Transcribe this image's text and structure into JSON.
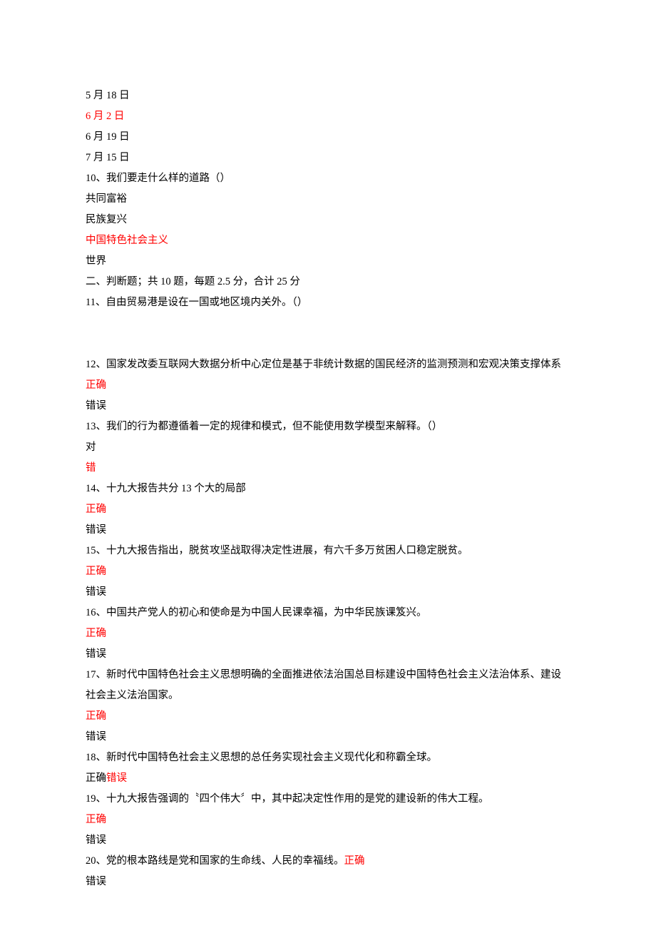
{
  "lines": [
    {
      "text": "5 月 18 日",
      "red": false
    },
    {
      "text": "6 月 2 日",
      "red": true
    },
    {
      "text": "6 月 19 日",
      "red": false
    },
    {
      "text": "7 月 15 日",
      "red": false
    },
    {
      "text": "10、我们要走什么样的道路（）",
      "red": false
    },
    {
      "text": "共同富裕",
      "red": false
    },
    {
      "text": "民族复兴",
      "red": false
    },
    {
      "text": "中国特色社会主义",
      "red": true
    },
    {
      "text": "世界",
      "red": false
    },
    {
      "text": "二、判断题；共 10 题，每题 2.5 分，合计 25 分",
      "red": false
    },
    {
      "text": "11、自由贸易港是设在一国或地区境内关外。（）",
      "red": false
    },
    {
      "text": "",
      "red": false
    },
    {
      "text": "",
      "red": false
    }
  ],
  "mixed": [
    {
      "segments": [
        {
          "text": "12、国家发改委互联网大数据分析中心定位是基于非统计数据的国民经济的监测预测和宏观决策支撑体系",
          "red": false
        },
        {
          "text": "正确",
          "red": true
        }
      ]
    },
    {
      "segments": [
        {
          "text": "错误",
          "red": false
        }
      ]
    },
    {
      "segments": [
        {
          "text": "13、我们的行为都遵循着一定的规律和模式，但不能使用数学模型来解释。（）",
          "red": false
        }
      ]
    },
    {
      "segments": [
        {
          "text": "对",
          "red": false
        }
      ]
    },
    {
      "segments": [
        {
          "text": "错",
          "red": true
        }
      ]
    },
    {
      "segments": [
        {
          "text": "14、十九大报告共分 13 个大的局部",
          "red": false
        }
      ]
    },
    {
      "segments": [
        {
          "text": "正确",
          "red": true
        }
      ]
    },
    {
      "segments": [
        {
          "text": "错误",
          "red": false
        }
      ]
    },
    {
      "segments": [
        {
          "text": "15、十九大报告指出，脱贫攻坚战取得决定性进展，有六千多万贫困人口稳定脱贫。",
          "red": false
        }
      ]
    },
    {
      "segments": [
        {
          "text": "正确",
          "red": true
        }
      ]
    },
    {
      "segments": [
        {
          "text": "错误",
          "red": false
        }
      ]
    },
    {
      "segments": [
        {
          "text": "16、中国共产党人的初心和使命是为中国人民课幸福，为中华民族课笈兴。",
          "red": false
        }
      ]
    },
    {
      "segments": [
        {
          "text": "正确",
          "red": true
        }
      ]
    },
    {
      "segments": [
        {
          "text": "错误",
          "red": false
        }
      ]
    },
    {
      "segments": [
        {
          "text": "17、新时代中国特色社会主义思想明确的全面推进依法治国总目标建设中国特色社会主义法治体系、建设社会主义法治国家。",
          "red": false
        }
      ]
    },
    {
      "segments": [
        {
          "text": "正确",
          "red": true
        }
      ]
    },
    {
      "segments": [
        {
          "text": "错误",
          "red": false
        }
      ]
    },
    {
      "segments": [
        {
          "text": "18、新时代中国特色社会主义思想的总任务实现社会主义现代化和称霸全球。",
          "red": false
        }
      ]
    },
    {
      "segments": [
        {
          "text": "正确",
          "red": false
        },
        {
          "text": "错误",
          "red": true
        }
      ]
    },
    {
      "segments": [
        {
          "text": "19、十九大报告强调的〝四个伟大〞中，其中起决定性作用的是党的建设新的伟大工程。",
          "red": false
        }
      ]
    },
    {
      "segments": [
        {
          "text": "正确",
          "red": true
        }
      ]
    },
    {
      "segments": [
        {
          "text": "错误",
          "red": false
        }
      ]
    },
    {
      "segments": [
        {
          "text": "20、党的根本路线是党和国家的生命线、人民的幸福线。",
          "red": false
        },
        {
          "text": "正确",
          "red": true
        }
      ]
    },
    {
      "segments": [
        {
          "text": "错误",
          "red": false
        }
      ]
    }
  ]
}
